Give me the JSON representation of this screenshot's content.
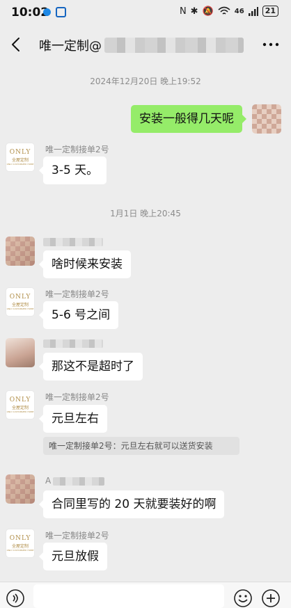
{
  "status": {
    "time": "10:02",
    "signal": "46",
    "battery": "21"
  },
  "header": {
    "title": "唯一定制@"
  },
  "messages": [
    {
      "type": "time",
      "text": "2024年12月20日 晚上19:52"
    },
    {
      "type": "self",
      "text": "安装一般得几天呢"
    },
    {
      "type": "other",
      "sender": "唯一定制接单2号",
      "text": "3-5 天。"
    },
    {
      "type": "time",
      "text": "1月1日 晚上20:45"
    },
    {
      "type": "other",
      "sender": "",
      "text": "啥时候来安装"
    },
    {
      "type": "other",
      "sender": "唯一定制接单2号",
      "text": "5-6 号之间"
    },
    {
      "type": "other",
      "sender": "",
      "text": "那这不是超时了"
    },
    {
      "type": "other",
      "sender": "唯一定制接单2号",
      "text": "元旦左右"
    },
    {
      "type": "quote",
      "text": "唯一定制接单2号：元旦左右就可以送货安装"
    },
    {
      "type": "other",
      "sender": "A",
      "text": "合同里写的 20 天就要装好的啊"
    },
    {
      "type": "other",
      "sender": "唯一定制接单2号",
      "text": "元旦放假"
    }
  ],
  "brand_avatar": {
    "top": "ONLY",
    "cn": "全屋定制",
    "sub": "ONLY CUSTOMIZED HOME"
  },
  "colors": {
    "self_bubble": "#95ec69",
    "background": "#ededed"
  },
  "icons": [
    "back-icon",
    "more-icon",
    "voice-icon",
    "emoji-icon",
    "plus-icon"
  ]
}
